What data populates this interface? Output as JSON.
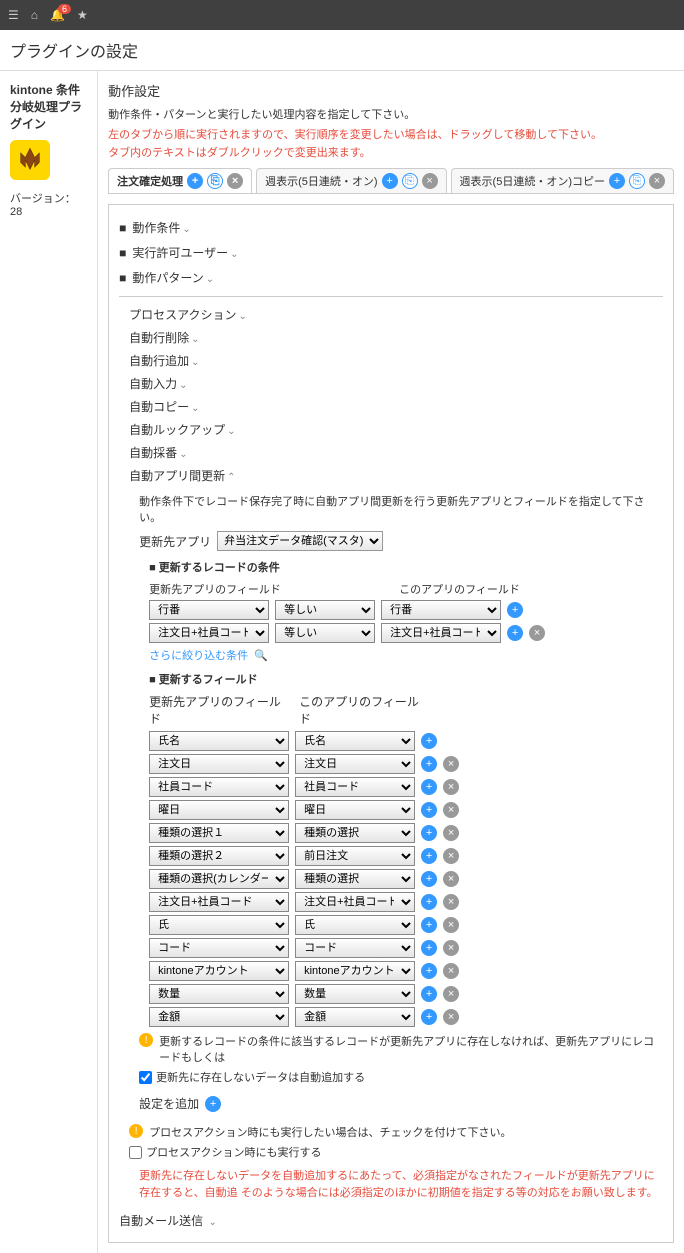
{
  "topbar": {
    "badge": "6"
  },
  "pageTitle": "プラグインの設定",
  "sidebar": {
    "pluginName": "kintone 条件分岐処理プラグイン",
    "version": "バージョン：28"
  },
  "settings": {
    "title": "動作設定",
    "desc": "動作条件・パターンと実行したい処理内容を指定して下さい。",
    "warn1": "左のタブから順に実行されますので、実行順序を変更したい場合は、ドラッグして移動して下さい。",
    "warn2": "タブ内のテキストはダブルクリックで変更出来ます。"
  },
  "tabs": [
    {
      "label": "注文確定処理",
      "active": true
    },
    {
      "label": "週表示(5日連続・オン)"
    },
    {
      "label": "週表示(5日連続・オン)コピー"
    }
  ],
  "collapse": [
    {
      "label": "動作条件"
    },
    {
      "label": "実行許可ユーザー"
    },
    {
      "label": "動作パターン"
    }
  ],
  "subs": [
    {
      "label": "プロセスアクション"
    },
    {
      "label": "自動行削除"
    },
    {
      "label": "自動行追加"
    },
    {
      "label": "自動入力"
    },
    {
      "label": "自動コピー"
    },
    {
      "label": "自動ルックアップ"
    },
    {
      "label": "自動採番"
    },
    {
      "label": "自動アプリ間更新",
      "open": true
    }
  ],
  "updateDesc": "動作条件下でレコード保存完了時に自動アプリ間更新を行う更新先アプリとフィールドを指定して下さい。",
  "targetAppLabel": "更新先アプリ",
  "targetAppValue": "弁当注文データ確認(マスタ)",
  "condition": {
    "title": "更新するレコードの条件",
    "colTarget": "更新先アプリのフィールド",
    "colThis": "このアプリのフィールド",
    "rows": [
      {
        "f1": "行番",
        "op": "等しい",
        "f2": "行番"
      },
      {
        "f1": "注文日+社員コード",
        "op": "等しい",
        "f2": "注文日+社員コード"
      }
    ],
    "filterLabel": "さらに絞り込む条件"
  },
  "fields": {
    "title": "更新するフィールド",
    "col1": "更新先アプリのフィールド",
    "col2": "このアプリのフィールド",
    "rows": [
      {
        "f1": "氏名",
        "f2": "氏名",
        "del": false
      },
      {
        "f1": "注文日",
        "f2": "注文日",
        "del": true
      },
      {
        "f1": "社員コード",
        "f2": "社員コード",
        "del": true
      },
      {
        "f1": "曜日",
        "f2": "曜日",
        "del": true
      },
      {
        "f1": "種類の選択１",
        "f2": "種類の選択",
        "del": true
      },
      {
        "f1": "種類の選択２",
        "f2": "前日注文",
        "del": true
      },
      {
        "f1": "種類の選択(カレンダー用)",
        "f2": "種類の選択",
        "del": true
      },
      {
        "f1": "注文日+社員コード",
        "f2": "注文日+社員コード",
        "del": true
      },
      {
        "f1": "氏",
        "f2": "氏",
        "del": true
      },
      {
        "f1": "コード",
        "f2": "コード",
        "del": true
      },
      {
        "f1": "kintoneアカウント",
        "f2": "kintoneアカウント",
        "del": true
      },
      {
        "f1": "数量",
        "f2": "数量",
        "del": true
      },
      {
        "f1": "金額",
        "f2": "金額",
        "del": true
      }
    ]
  },
  "notes": {
    "note1": "更新するレコードの条件に該当するレコードが更新先アプリに存在しなければ、更新先アプリにレコードもしくは",
    "check1": "更新先に存在しないデータは自動追加する",
    "check1Checked": true,
    "addSetting": "設定を追加",
    "note2": "プロセスアクション時にも実行したい場合は、チェックを付けて下さい。",
    "check2": "プロセスアクション時にも実行する",
    "check2Checked": false,
    "bottomWarn": "更新先に存在しないデータを自動追加するにあたって、必須指定がなされたフィールドが更新先アプリに存在すると、自動追\nそのような場合には必須指定のほかに初期値を指定する等の対応をお願い致します。"
  },
  "lastSub": "自動メール送信"
}
